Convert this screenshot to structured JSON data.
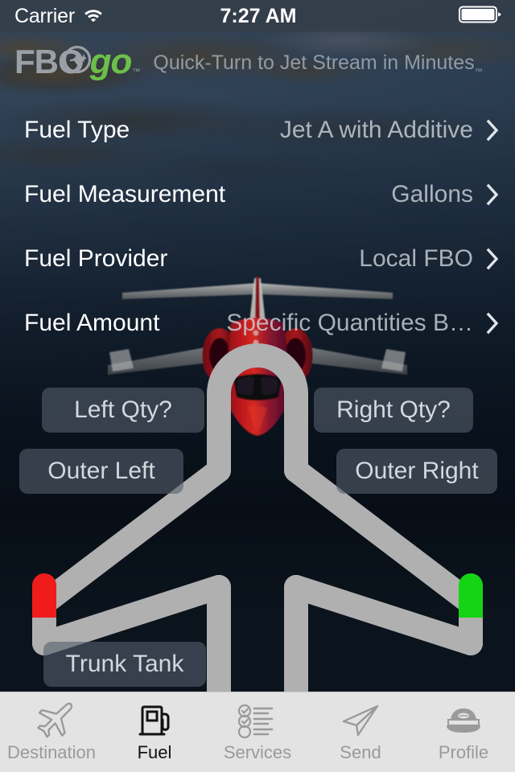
{
  "status_bar": {
    "carrier": "Carrier",
    "wifi_icon": "wifi-icon",
    "time": "7:27 AM",
    "battery_icon": "battery-full-icon"
  },
  "branding": {
    "logo_fbo": "FBO",
    "logo_go": "go",
    "logo_tm": "™",
    "tagline": "Quick-Turn to Jet Stream in Minutes",
    "tagline_tm": "™",
    "green": "#6cc04a",
    "gray": "#9aa0a6"
  },
  "fuel_rows": [
    {
      "label": "Fuel Type",
      "value": "Jet A with Additive",
      "chevron": "chevron-right-icon"
    },
    {
      "label": "Fuel Measurement",
      "value": "Gallons",
      "chevron": "chevron-right-icon"
    },
    {
      "label": "Fuel Provider",
      "value": "Local FBO",
      "chevron": "chevron-right-icon"
    },
    {
      "label": "Fuel Amount",
      "value": "Specific Quantities B…",
      "chevron": "chevron-right-icon"
    }
  ],
  "aircraft": {
    "outline_color": "#b0b0b0",
    "left_wingtip_color": "#f01c1c",
    "right_wingtip_color": "#14d414",
    "tank_buttons": [
      {
        "id": "left-qty",
        "label": "Left Qty?"
      },
      {
        "id": "right-qty",
        "label": "Right Qty?"
      },
      {
        "id": "outer-left",
        "label": "Outer Left"
      },
      {
        "id": "outer-right",
        "label": "Outer Right"
      },
      {
        "id": "trunk-tank",
        "label": "Trunk Tank"
      }
    ]
  },
  "tab_bar": {
    "active": "Fuel",
    "tabs": [
      {
        "label": "Destination",
        "icon": "airplane-icon",
        "active": false
      },
      {
        "label": "Fuel",
        "icon": "fuel-pump-icon",
        "active": true
      },
      {
        "label": "Services",
        "icon": "checklist-icon",
        "active": false
      },
      {
        "label": "Send",
        "icon": "paper-plane-icon",
        "active": false
      },
      {
        "label": "Profile",
        "icon": "pilot-cap-icon",
        "active": false
      }
    ]
  }
}
